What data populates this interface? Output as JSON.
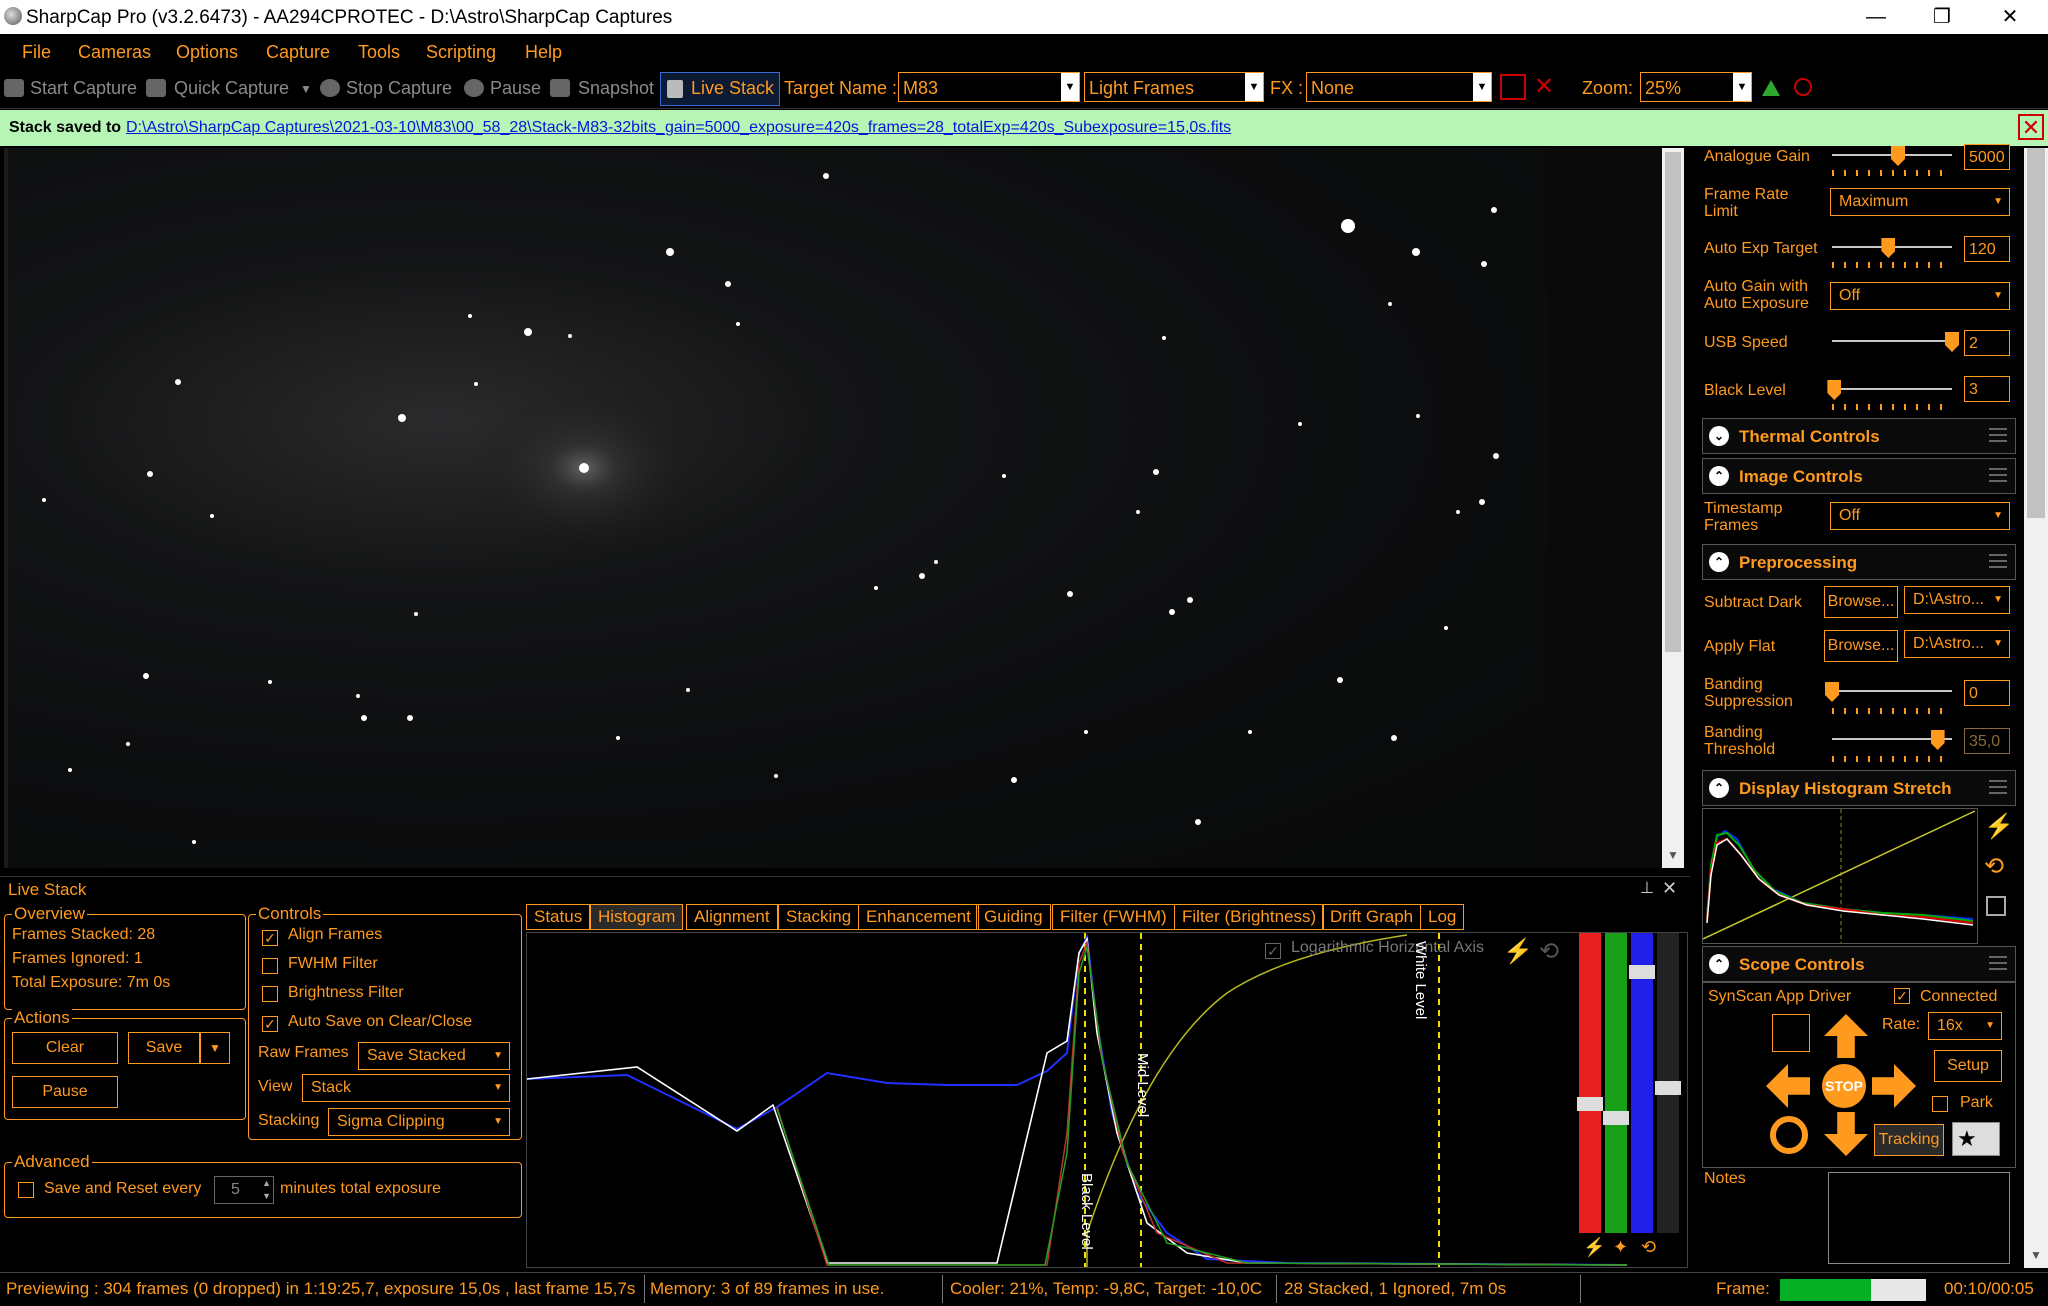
{
  "window": {
    "title": "SharpCap Pro (v3.2.6473) - AA294CPROTEC - D:\\Astro\\SharpCap Captures",
    "minimize": "—",
    "maximize": "❐",
    "close": "✕"
  },
  "menu": [
    "File",
    "Cameras",
    "Options",
    "Capture",
    "Tools",
    "Scripting",
    "Help"
  ],
  "toolbar": {
    "start_capture": "Start Capture",
    "quick_capture": "Quick Capture",
    "stop_capture": "Stop Capture",
    "pause": "Pause",
    "snapshot": "Snapshot",
    "live_stack": "Live Stack",
    "target_label": "Target Name :",
    "target_value": "M83",
    "frame_type": "Light Frames",
    "fx_label": "FX :",
    "fx_value": "None",
    "zoom_label": "Zoom:",
    "zoom_value": "25%"
  },
  "notification": {
    "message": "Stack saved to",
    "path": "D:\\Astro\\SharpCap Captures\\2021-03-10\\M83\\00_58_28\\Stack-M83-32bits_gain=5000_exposure=420s_frames=28_totalExp=420s_Subexposure=15,0s.fits"
  },
  "camera_controls": {
    "analogue_gain": {
      "label": "Analogue Gain",
      "value": "5000",
      "level": 0.55
    },
    "frame_rate_limit": {
      "label": "Frame Rate Limit",
      "value": "Maximum"
    },
    "auto_exp_target": {
      "label": "Auto Exp Target",
      "value": "120",
      "level": 0.47
    },
    "auto_gain": {
      "label": "Auto Gain with Auto Exposure",
      "value": "Off"
    },
    "usb_speed": {
      "label": "USB Speed",
      "value": "2",
      "level": 1.0
    },
    "black_level": {
      "label": "Black Level",
      "value": "3",
      "level": 0.02
    }
  },
  "sections": {
    "thermal": "Thermal Controls",
    "image": "Image Controls",
    "preprocessing": "Preprocessing",
    "histogram_stretch": "Display Histogram Stretch",
    "scope": "Scope Controls"
  },
  "image_controls": {
    "timestamp": {
      "label": "Timestamp Frames",
      "value": "Off"
    }
  },
  "preprocessing": {
    "subtract_dark": {
      "label": "Subtract Dark",
      "browse": "Browse...",
      "value": "D:\\Astro..."
    },
    "apply_flat": {
      "label": "Apply Flat",
      "browse": "Browse...",
      "value": "D:\\Astro..."
    },
    "banding_suppression": {
      "label": "Banding Suppression",
      "value": "0",
      "level": 0.0
    },
    "banding_threshold": {
      "label": "Banding Threshold",
      "value": "35,0",
      "level": 0.88
    }
  },
  "scope": {
    "driver": "SynScan App Driver",
    "connected": "Connected",
    "rate_label": "Rate:",
    "rate_value": "16x",
    "setup": "Setup",
    "stop": "STOP",
    "park": "Park",
    "tracking": "Tracking",
    "notes_label": "Notes"
  },
  "live_stack": {
    "title": "Live Stack",
    "overview_title": "Overview",
    "frames_stacked": "Frames Stacked: 28",
    "frames_ignored": "Frames Ignored:  1",
    "total_exposure": "Total Exposure:   7m 0s",
    "actions_title": "Actions",
    "clear": "Clear",
    "save": "Save",
    "pause": "Pause",
    "controls_title": "Controls",
    "align_frames": "Align Frames",
    "fwhm_filter": "FWHM Filter",
    "brightness_filter": "Brightness Filter",
    "auto_save": "Auto Save on Clear/Close",
    "raw_frames_label": "Raw Frames",
    "raw_frames_value": "Save Stacked",
    "view_label": "View",
    "view_value": "Stack",
    "stacking_label": "Stacking",
    "stacking_value": "Sigma Clipping",
    "advanced_title": "Advanced",
    "save_reset": "Save and Reset every",
    "minutes_value": "5",
    "minutes_suffix": "minutes total exposure",
    "pin": "⊥",
    "close": "✕"
  },
  "tabs": [
    "Status",
    "Histogram",
    "Alignment",
    "Stacking",
    "Enhancement",
    "Guiding",
    "Filter (FWHM)",
    "Filter (Brightness)",
    "Drift Graph",
    "Log"
  ],
  "histogram": {
    "log_axis": "Logarithmic Horizontal Axis",
    "black_level": "Black Level",
    "mid_level": "Mid Level",
    "white_level": "White Level"
  },
  "status": {
    "previewing": "Previewing : 304 frames (0 dropped) in 1:19:25,7, exposure 15,0s , last frame 15,7s",
    "memory": "Memory: 3 of 89 frames in use.",
    "cooler": "Cooler: 21%, Temp: -9,8C, Target: -10,0C",
    "stacked": "28 Stacked, 1 Ignored, 7m 0s",
    "frame_label": "Frame:",
    "frame_time": "00:10/00:05",
    "progress": 0.62
  },
  "colors": {
    "accent": "#ff9a1f",
    "notify_bg": "#b7f5b7",
    "link": "#0018d8"
  }
}
